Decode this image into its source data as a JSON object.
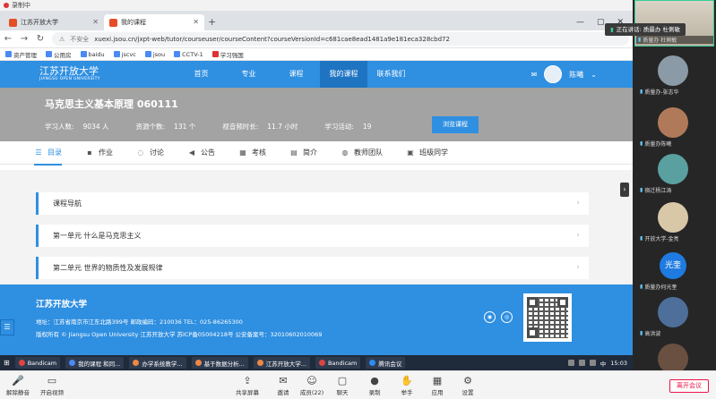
{
  "recording": {
    "label": "录制中"
  },
  "browser": {
    "tabs": [
      {
        "title": "江苏开放大学",
        "active": false
      },
      {
        "title": "我的课程",
        "active": true
      }
    ],
    "new_tab": "+",
    "address": {
      "security": "不安全",
      "url": "xuexi.jsou.cn/jxpt-web/tutor/courseuser/courseContent?courseVersionId=c681cae8ead1481a9e181eca328cbd72"
    },
    "speaking": "正在讲话: 质最办 杜俐敏",
    "bookmarks": [
      "资产管理",
      "公用房",
      "baidu",
      "jscvc",
      "jsou",
      "CCTV-1",
      "学习强国"
    ]
  },
  "site": {
    "logo_cn": "江苏开放大学",
    "logo_en": "JIANGSU OPEN UNIVERSITY",
    "menu": [
      "首页",
      "专业",
      "课程",
      "我的课程",
      "联系我们"
    ],
    "active_menu": "我的课程",
    "user_name": "陈曦"
  },
  "course": {
    "title": "马克思主义基本原理  060111",
    "stats": [
      {
        "label": "学习人数:",
        "value": "9034 人"
      },
      {
        "label": "资源个数:",
        "value": "131 个"
      },
      {
        "label": "视音频时长:",
        "value": "11.7 小时"
      },
      {
        "label": "学习活动:",
        "value": "19"
      }
    ],
    "browse_button": "浏览课程"
  },
  "subtabs": [
    {
      "label": "目录",
      "icon": "list-icon",
      "glyph": "☰",
      "active": true
    },
    {
      "label": "作业",
      "icon": "homework-icon",
      "glyph": "▪",
      "active": false
    },
    {
      "label": "讨论",
      "icon": "discussion-icon",
      "glyph": "◌",
      "active": false
    },
    {
      "label": "公告",
      "icon": "announcement-icon",
      "glyph": "◀",
      "active": false
    },
    {
      "label": "考核",
      "icon": "assessment-icon",
      "glyph": "▦",
      "active": false
    },
    {
      "label": "简介",
      "icon": "intro-icon",
      "glyph": "▤",
      "active": false
    },
    {
      "label": "教师团队",
      "icon": "team-icon",
      "glyph": "◍",
      "active": false
    },
    {
      "label": "班级同学",
      "icon": "classmates-icon",
      "glyph": "▣",
      "active": false
    }
  ],
  "outline": [
    "课程导航",
    "第一单元  什么是马克思主义",
    "第二单元  世界的物质性及发展规律"
  ],
  "footer": {
    "title": "江苏开放大学",
    "address": "地址：江苏省南京市江东北路399号    邮政编码：210036    TEL：025-86265300",
    "copyright": "版权所有 © Jiangsu Open University 江苏开放大学    苏ICP备05004218号    公安备案号：32010602010069"
  },
  "taskbar": {
    "items": [
      "Bandicam",
      "我的课程 和同...",
      "办学系统教学...",
      "基于数据分析...",
      "江苏开放大学...",
      "Bandicam",
      "腾讯会议"
    ],
    "ime": "中",
    "time": "15:03"
  },
  "meeting": {
    "buttons": [
      {
        "label": "解除静音",
        "icon": "mic-icon",
        "glyph": "🎤"
      },
      {
        "label": "开启视频",
        "icon": "camera-icon",
        "glyph": "▭"
      },
      {
        "label": "共享屏幕",
        "icon": "share-screen-icon",
        "glyph": "⇪"
      },
      {
        "label": "邀请",
        "icon": "invite-icon",
        "glyph": "✉"
      },
      {
        "label": "成员(22)",
        "icon": "members-icon",
        "glyph": "☺"
      },
      {
        "label": "聊天",
        "icon": "chat-icon",
        "glyph": "▢"
      },
      {
        "label": "录制",
        "icon": "record-icon",
        "glyph": "●"
      },
      {
        "label": "举手",
        "icon": "raise-hand-icon",
        "glyph": "✋"
      },
      {
        "label": "应用",
        "icon": "apps-icon",
        "glyph": "▦"
      },
      {
        "label": "设置",
        "icon": "settings-icon",
        "glyph": "⚙"
      }
    ],
    "leave": "离开会议"
  },
  "participants": [
    {
      "name": "质量办 杜俐敏",
      "camera": true,
      "color": "#c9b49a"
    },
    {
      "name": "质量办-张志华",
      "camera": false,
      "color": "#8a9aa6"
    },
    {
      "name": "质量办陈曦",
      "camera": false,
      "color": "#b07a5a"
    },
    {
      "name": "宿迁杨江涛",
      "camera": false,
      "color": "#5aa0a0"
    },
    {
      "name": "开放大学-金亮",
      "camera": false,
      "color": "#d8c8a8"
    },
    {
      "name": "质量办何光奎",
      "camera": false,
      "text": "光奎",
      "color": "#1e7be0"
    },
    {
      "name": "高洪波",
      "camera": false,
      "color": "#4d6f9a"
    },
    {
      "name": "",
      "camera": false,
      "color": "#6a5040"
    }
  ]
}
